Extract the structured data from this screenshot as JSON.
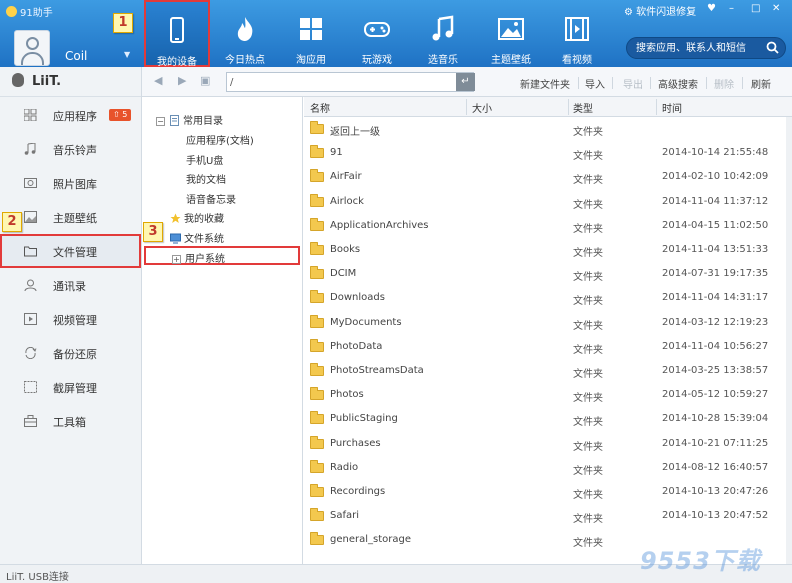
{
  "app": {
    "title": "91助手"
  },
  "user": {
    "name": "Coil"
  },
  "nav_tabs": [
    {
      "label": "我的设备",
      "icon": "phone-icon",
      "active": true
    },
    {
      "label": "今日热点",
      "icon": "flame-icon"
    },
    {
      "label": "淘应用",
      "icon": "apps-grid-icon"
    },
    {
      "label": "玩游戏",
      "icon": "gamepad-icon"
    },
    {
      "label": "选音乐",
      "icon": "music-note-icon"
    },
    {
      "label": "主题壁纸",
      "icon": "picture-icon"
    },
    {
      "label": "看视频",
      "icon": "film-icon"
    }
  ],
  "window": {
    "notice": "软件闪退修复",
    "min": "–",
    "max": "□",
    "close": "✕"
  },
  "search": {
    "placeholder": "搜索应用、联系人和短信"
  },
  "callouts": [
    "1",
    "2",
    "3"
  ],
  "device": {
    "name": "LiiT."
  },
  "sidebar": {
    "items": [
      {
        "label": "应用程序",
        "icon": "apps-icon",
        "badge": "5"
      },
      {
        "label": "音乐铃声",
        "icon": "music-icon"
      },
      {
        "label": "照片图库",
        "icon": "photo-icon"
      },
      {
        "label": "主题壁纸",
        "icon": "wallpaper-icon"
      },
      {
        "label": "文件管理",
        "icon": "folder-icon",
        "active": true
      },
      {
        "label": "通讯录",
        "icon": "contacts-icon"
      },
      {
        "label": "视频管理",
        "icon": "video-icon"
      },
      {
        "label": "备份还原",
        "icon": "backup-icon"
      },
      {
        "label": "截屏管理",
        "icon": "screenshot-icon"
      },
      {
        "label": "工具箱",
        "icon": "toolbox-icon"
      }
    ]
  },
  "toolbar": {
    "path": "/",
    "new_folder": "新建文件夹",
    "import": "导入",
    "export": "导出",
    "advanced_search": "高级搜索",
    "delete": "删除",
    "refresh": "刷新"
  },
  "tree": {
    "common_dirs": "常用目录",
    "apps_docs": "应用程序(文档)",
    "usb_disk": "手机U盘",
    "my_docs": "我的文档",
    "voice_memo": "语音备忘录",
    "favorites": "我的收藏",
    "file_system": "文件系统",
    "user_system": "用户系统"
  },
  "list": {
    "columns": {
      "name": "名称",
      "size": "大小",
      "type": "类型",
      "time": "时间"
    },
    "rows": [
      {
        "name": "返回上一级",
        "type": "文件夹",
        "time": ""
      },
      {
        "name": "91",
        "type": "文件夹",
        "time": "2014-10-14 21:55:48"
      },
      {
        "name": "AirFair",
        "type": "文件夹",
        "time": "2014-02-10 10:42:09"
      },
      {
        "name": "Airlock",
        "type": "文件夹",
        "time": "2014-11-04 11:37:12"
      },
      {
        "name": "ApplicationArchives",
        "type": "文件夹",
        "time": "2014-04-15 11:02:50"
      },
      {
        "name": "Books",
        "type": "文件夹",
        "time": "2014-11-04 13:51:33"
      },
      {
        "name": "DCIM",
        "type": "文件夹",
        "time": "2014-07-31 19:17:35"
      },
      {
        "name": "Downloads",
        "type": "文件夹",
        "time": "2014-11-04 14:31:17"
      },
      {
        "name": "MyDocuments",
        "type": "文件夹",
        "time": "2014-03-12 12:19:23"
      },
      {
        "name": "PhotoData",
        "type": "文件夹",
        "time": "2014-11-04 10:56:27"
      },
      {
        "name": "PhotoStreamsData",
        "type": "文件夹",
        "time": "2014-03-25 13:38:57"
      },
      {
        "name": "Photos",
        "type": "文件夹",
        "time": "2014-05-12 10:59:27"
      },
      {
        "name": "PublicStaging",
        "type": "文件夹",
        "time": "2014-10-28 15:39:04"
      },
      {
        "name": "Purchases",
        "type": "文件夹",
        "time": "2014-10-21 07:11:25"
      },
      {
        "name": "Radio",
        "type": "文件夹",
        "time": "2014-08-12 16:40:57"
      },
      {
        "name": "Recordings",
        "type": "文件夹",
        "time": "2014-10-13 20:47:26"
      },
      {
        "name": "Safari",
        "type": "文件夹",
        "time": "2014-10-13 20:47:52"
      },
      {
        "name": "general_storage",
        "type": "文件夹",
        "time": ""
      }
    ]
  },
  "status": {
    "text": "LiiT. USB连接"
  },
  "watermark": "9553下载",
  "colors": {
    "brand": "#2a7fd4",
    "highlight": "#e23a3a",
    "callout": "#fff7b0"
  }
}
